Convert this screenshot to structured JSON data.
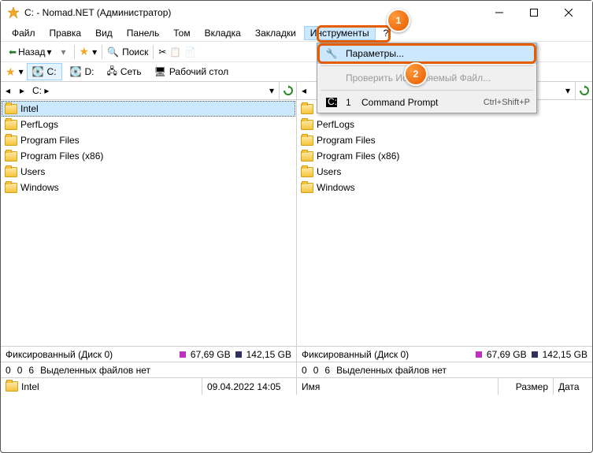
{
  "window": {
    "title": "C: - Nomad.NET (Администратор)"
  },
  "menu": {
    "file": "Файл",
    "edit": "Правка",
    "view": "Вид",
    "panel": "Панель",
    "volume": "Том",
    "tab": "Вкладка",
    "bookmarks": "Закладки",
    "tools": "Инструменты",
    "help": "?"
  },
  "toolbar": {
    "back": "Назад",
    "search_label": "Поиск"
  },
  "tabs": {
    "c": "C:",
    "d": "D:",
    "network": "Сеть",
    "desktop": "Рабочий стол"
  },
  "breadcrumb": {
    "path": "C:"
  },
  "folders": [
    "Intel",
    "PerfLogs",
    "Program Files",
    "Program Files (x86)",
    "Users",
    "Windows"
  ],
  "status": {
    "disk_label": "Фиксированный (Диск 0)",
    "used": "67,69 GB",
    "total": "142,15 GB"
  },
  "selection": {
    "n1": "0",
    "n2": "0",
    "n3": "6",
    "text": "Выделенных файлов нет"
  },
  "footer_left": {
    "name": "Intel",
    "date": "09.04.2022 14:05"
  },
  "footer_right": {
    "name_col": "Имя",
    "size_col": "Размер",
    "date_col": "Дата"
  },
  "dropdown": {
    "options": "Параметры...",
    "check_exe": "Проверить Исполняемый Файл...",
    "cmd_num": "1",
    "cmd": "Command Prompt",
    "cmd_shortcut": "Ctrl+Shift+P"
  },
  "callouts": {
    "one": "1",
    "two": "2"
  }
}
